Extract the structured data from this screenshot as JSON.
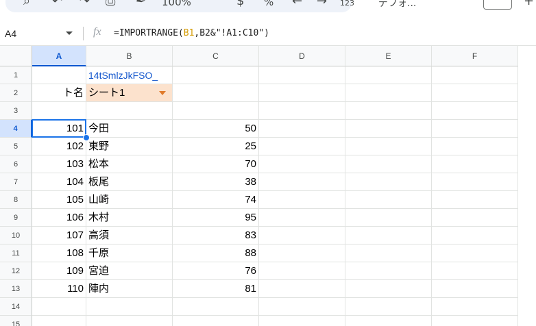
{
  "toolbar": {
    "zoom": "100%",
    "percent_label": "%",
    "format_label": "123",
    "font_label": "デフォ..."
  },
  "formula_bar": {
    "cell_ref": "A4",
    "fx_label": "fx",
    "formula_prefix": "=IMPORTRANGE(",
    "formula_ref1": "B1",
    "formula_middle": ",B2&\"!A1:C10\")"
  },
  "columns": [
    "A",
    "B",
    "C",
    "D",
    "E",
    "F"
  ],
  "rows": [
    "1",
    "2",
    "3",
    "4",
    "5",
    "6",
    "7",
    "8",
    "9",
    "10",
    "11",
    "12",
    "13",
    "14",
    "15"
  ],
  "cells": {
    "b1": "14tSmlzJkFSO_",
    "a2": "ト名",
    "b2": "シート1"
  },
  "data_rows": [
    {
      "id": "101",
      "name": "今田",
      "score": "50"
    },
    {
      "id": "102",
      "name": "東野",
      "score": "25"
    },
    {
      "id": "103",
      "name": "松本",
      "score": "70"
    },
    {
      "id": "104",
      "name": "板尾",
      "score": "38"
    },
    {
      "id": "105",
      "name": "山崎",
      "score": "74"
    },
    {
      "id": "106",
      "name": "木村",
      "score": "95"
    },
    {
      "id": "107",
      "name": "高須",
      "score": "83"
    },
    {
      "id": "108",
      "name": "千原",
      "score": "88"
    },
    {
      "id": "109",
      "name": "宮迫",
      "score": "76"
    },
    {
      "id": "110",
      "name": "陣内",
      "score": "81"
    }
  ],
  "colors": {
    "selection": "#1a73e8",
    "chip_bg": "#fce2cd",
    "link": "#1155cc"
  }
}
